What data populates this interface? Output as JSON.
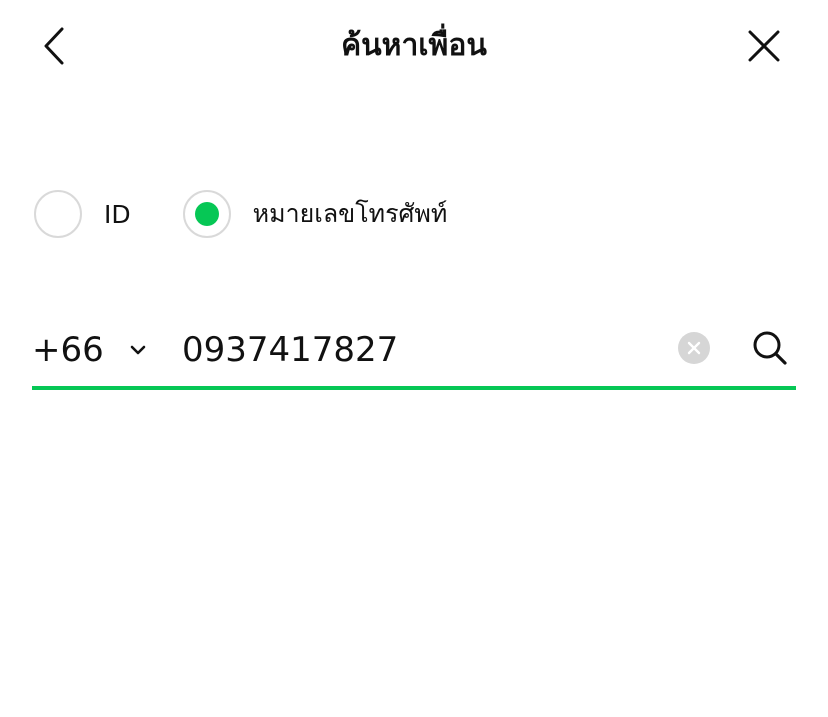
{
  "header": {
    "title": "ค้นหาเพื่อน",
    "back_icon": "chevron-left-icon",
    "close_icon": "close-icon"
  },
  "search_type": {
    "options": [
      {
        "label": "ID",
        "selected": false
      },
      {
        "label": "หมายเลขโทรศัพท์",
        "selected": true
      }
    ]
  },
  "phone": {
    "country_code": "+66",
    "country_chevron_icon": "chevron-down-icon",
    "value": "0937417827",
    "clear_icon": "clear-icon",
    "search_icon": "search-icon"
  },
  "colors": {
    "accent": "#06c755",
    "text": "#111111",
    "radio_border": "#d9d9d9",
    "clear_bg": "#d6d6d6"
  }
}
